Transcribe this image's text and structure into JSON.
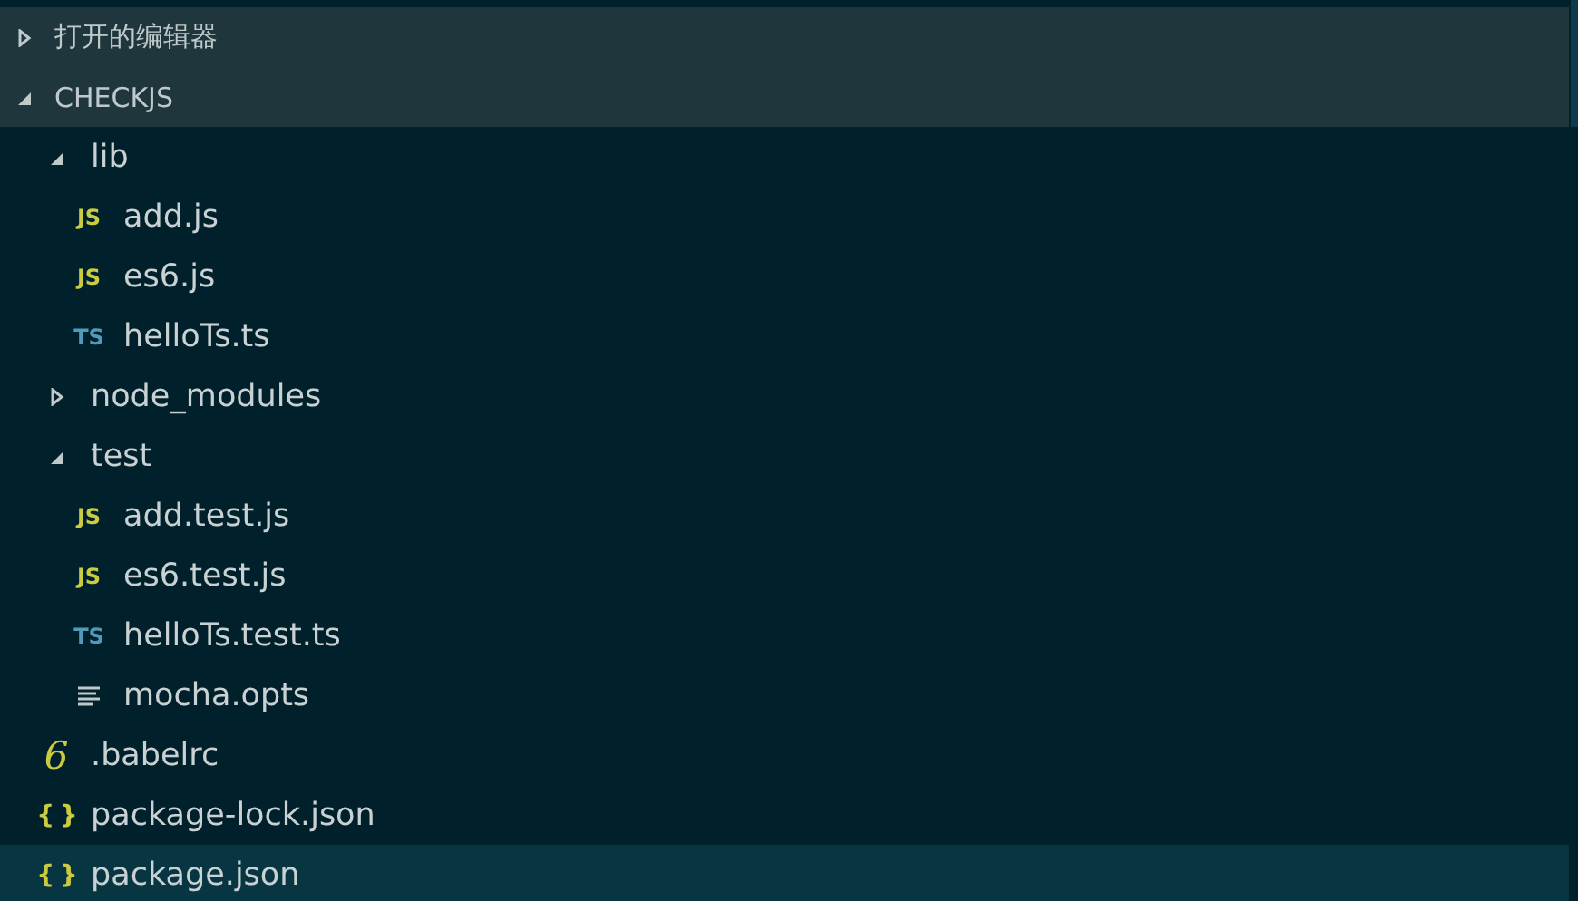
{
  "sections": [
    {
      "title": "打开的编辑器",
      "expanded": false
    },
    {
      "title": "CHECKJS",
      "expanded": true
    }
  ],
  "tree": [
    {
      "kind": "folder",
      "name": "lib",
      "expanded": true,
      "selected": false,
      "children": [
        {
          "kind": "js",
          "icon_text": "JS",
          "name": "add.js",
          "selected": false
        },
        {
          "kind": "js",
          "icon_text": "JS",
          "name": "es6.js",
          "selected": false
        },
        {
          "kind": "ts",
          "icon_text": "TS",
          "name": "helloTs.ts",
          "selected": false
        }
      ]
    },
    {
      "kind": "folder",
      "name": "node_modules",
      "expanded": false,
      "selected": false
    },
    {
      "kind": "folder",
      "name": "test",
      "expanded": true,
      "selected": false,
      "children": [
        {
          "kind": "js",
          "icon_text": "JS",
          "name": "add.test.js",
          "selected": false
        },
        {
          "kind": "js",
          "icon_text": "JS",
          "name": "es6.test.js",
          "selected": false
        },
        {
          "kind": "ts",
          "icon_text": "TS",
          "name": "helloTs.test.ts",
          "selected": false
        },
        {
          "kind": "text",
          "name": "mocha.opts",
          "selected": false
        }
      ]
    },
    {
      "kind": "babel",
      "icon_text": "6",
      "name": ".babelrc",
      "selected": false
    },
    {
      "kind": "json",
      "icon_text": "{ }",
      "name": "package-lock.json",
      "selected": false
    },
    {
      "kind": "json",
      "icon_text": "{ }",
      "name": "package.json",
      "selected": true
    }
  ]
}
